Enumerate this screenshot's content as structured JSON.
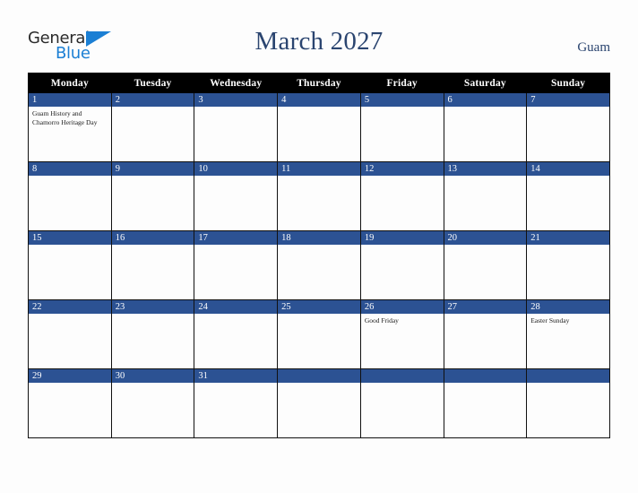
{
  "brand": {
    "name_part1": "General",
    "name_part2": "Blue",
    "mark": "triangle-icon",
    "color_dark": "#2b2b2b",
    "color_blue": "#1b7fd4"
  },
  "header": {
    "title": "March 2027",
    "location": "Guam",
    "title_color": "#2b4570"
  },
  "theme": {
    "header_row_bg": "#000000",
    "header_row_fg": "#ffffff",
    "date_bar_bg": "#2c5293",
    "date_bar_fg": "#ffffff",
    "cell_bg": "#fdfdfd",
    "page_bg": "#fdfdfd",
    "grid_line": "#111111"
  },
  "weekday_headers": [
    "Monday",
    "Tuesday",
    "Wednesday",
    "Thursday",
    "Friday",
    "Saturday",
    "Sunday"
  ],
  "weeks": [
    [
      {
        "day": "1",
        "events": [
          "Guam History and Chamorro Heritage Day"
        ]
      },
      {
        "day": "2",
        "events": []
      },
      {
        "day": "3",
        "events": []
      },
      {
        "day": "4",
        "events": []
      },
      {
        "day": "5",
        "events": []
      },
      {
        "day": "6",
        "events": []
      },
      {
        "day": "7",
        "events": []
      }
    ],
    [
      {
        "day": "8",
        "events": []
      },
      {
        "day": "9",
        "events": []
      },
      {
        "day": "10",
        "events": []
      },
      {
        "day": "11",
        "events": []
      },
      {
        "day": "12",
        "events": []
      },
      {
        "day": "13",
        "events": []
      },
      {
        "day": "14",
        "events": []
      }
    ],
    [
      {
        "day": "15",
        "events": []
      },
      {
        "day": "16",
        "events": []
      },
      {
        "day": "17",
        "events": []
      },
      {
        "day": "18",
        "events": []
      },
      {
        "day": "19",
        "events": []
      },
      {
        "day": "20",
        "events": []
      },
      {
        "day": "21",
        "events": []
      }
    ],
    [
      {
        "day": "22",
        "events": []
      },
      {
        "day": "23",
        "events": []
      },
      {
        "day": "24",
        "events": []
      },
      {
        "day": "25",
        "events": []
      },
      {
        "day": "26",
        "events": [
          "Good Friday"
        ]
      },
      {
        "day": "27",
        "events": []
      },
      {
        "day": "28",
        "events": [
          "Easter Sunday"
        ]
      }
    ],
    [
      {
        "day": "29",
        "events": []
      },
      {
        "day": "30",
        "events": []
      },
      {
        "day": "31",
        "events": []
      },
      {
        "day": "",
        "events": []
      },
      {
        "day": "",
        "events": []
      },
      {
        "day": "",
        "events": []
      },
      {
        "day": "",
        "events": []
      }
    ]
  ]
}
